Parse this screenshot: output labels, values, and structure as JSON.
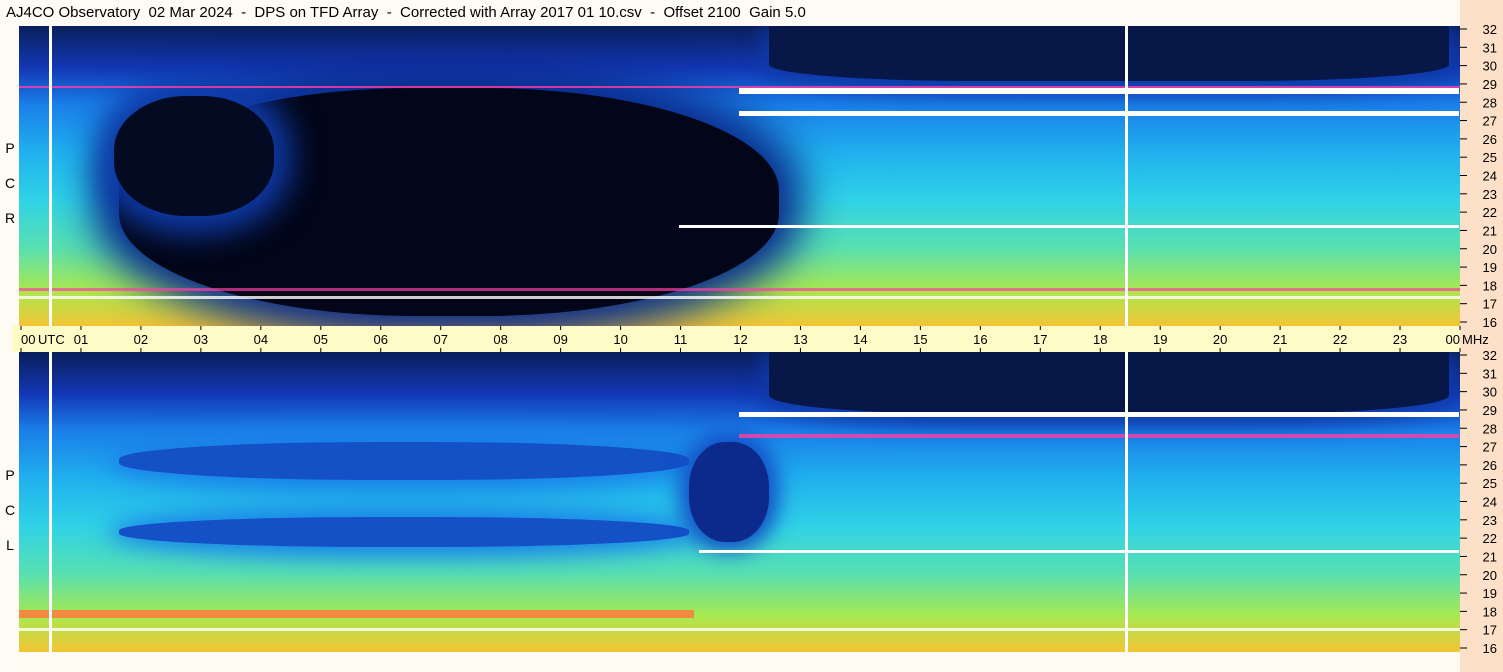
{
  "title": "AJ4CO Observatory  02 Mar 2024  -  DPS on TFD Array  -  Corrected with Array 2017 01 10.csv  -  Offset 2100  Gain 5.0",
  "chart_data": {
    "type": "heatmap",
    "panels": [
      {
        "name": "RCP",
        "label": [
          "R",
          "C",
          "P"
        ]
      },
      {
        "name": "LCP",
        "label": [
          "L",
          "C",
          "P"
        ]
      }
    ],
    "x": {
      "unit_label": "UTC",
      "range": [
        0,
        24
      ],
      "tick_labels": [
        "00",
        "01",
        "02",
        "03",
        "04",
        "05",
        "06",
        "07",
        "08",
        "09",
        "10",
        "11",
        "12",
        "13",
        "14",
        "15",
        "16",
        "17",
        "18",
        "19",
        "20",
        "21",
        "22",
        "23",
        "00"
      ]
    },
    "y": {
      "unit_label": "MHz",
      "range": [
        16,
        32
      ],
      "tick_labels": [
        "32",
        "31",
        "30",
        "29",
        "28",
        "27",
        "26",
        "25",
        "24",
        "23",
        "22",
        "21",
        "20",
        "19",
        "18",
        "17",
        "16"
      ]
    },
    "colors": {
      "low": "#000000",
      "deep": "#0a1f5a",
      "mid_low": "#1a7ee8",
      "mid": "#2fd2e6",
      "mid_high": "#a8e850",
      "high": "#f3c535",
      "hot": "#ff3da6",
      "saturate": "#ffffff"
    },
    "vertical_markers_utc": [
      0.5,
      18.4
    ]
  }
}
